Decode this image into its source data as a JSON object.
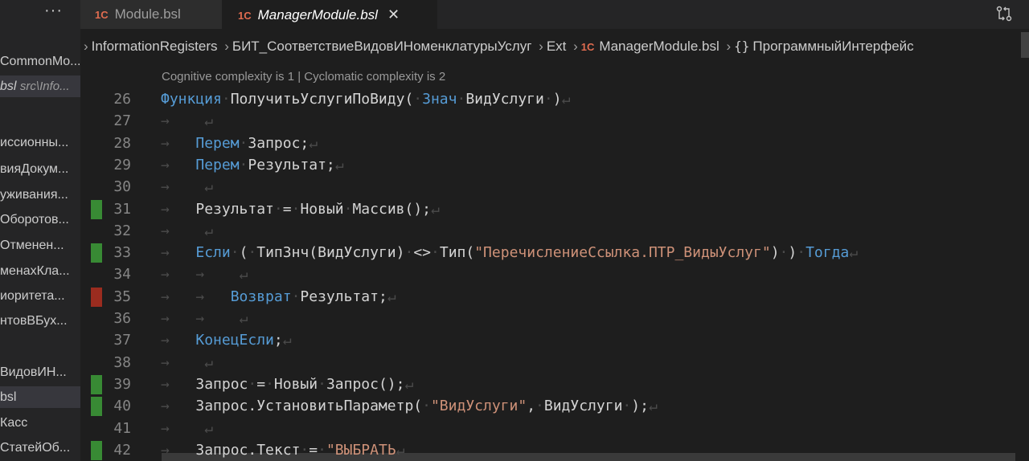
{
  "sidebar": {
    "dots": "···",
    "items": [
      {
        "text": "CommonMo...",
        "sub": "",
        "sel": false
      },
      {
        "text": "bsl",
        "sub": "src\\Info...",
        "sel": true
      },
      {
        "text": "иссионны...",
        "sub": "",
        "sel": false
      },
      {
        "text": "вияДокум...",
        "sub": "",
        "sel": false
      },
      {
        "text": "уживания...",
        "sub": "",
        "sel": false
      },
      {
        "text": "Оборотов...",
        "sub": "",
        "sel": false
      },
      {
        "text": "Отменен...",
        "sub": "",
        "sel": false
      },
      {
        "text": "менахКла...",
        "sub": "",
        "sel": false
      },
      {
        "text": "иоритета...",
        "sub": "",
        "sel": false
      },
      {
        "text": "нтовВБух...",
        "sub": "",
        "sel": false
      },
      {
        "text": "ВидовИН...",
        "sub": "",
        "sel": false
      },
      {
        "text": "bsl",
        "sub": "",
        "sel": true
      },
      {
        "text": "Касс",
        "sub": "",
        "sel": false
      },
      {
        "text": "СтатейОб...",
        "sub": "",
        "sel": false
      }
    ]
  },
  "tabs": [
    {
      "logo": "1C",
      "name": "Module.bsl",
      "active": false
    },
    {
      "logo": "1C",
      "name": "ManagerModule.bsl",
      "active": true,
      "close": "✕"
    }
  ],
  "breadcrumb": {
    "parts": [
      "InformationRegisters",
      "БИТ_СоответствиеВидовИНоменклатурыУслуг",
      "Ext",
      "ManagerModule.bsl",
      "ПрограммныйИнтерфейс"
    ],
    "logo": "1C",
    "braces": "{}"
  },
  "editor": {
    "codelens": "Cognitive complexity is 1 | Cyclomatic complexity is 2",
    "lines": [
      {
        "n": "26",
        "segs": [
          [
            "kw",
            "Функция"
          ],
          [
            "ws",
            "·"
          ],
          [
            "plain",
            "ПолучитьУслугиПоВиду("
          ],
          [
            "ws",
            "·"
          ],
          [
            "kw",
            "Знач"
          ],
          [
            "ws",
            "·"
          ],
          [
            "plain",
            "ВидУслуги"
          ],
          [
            "ws",
            "·"
          ],
          [
            "plain",
            ")"
          ],
          [
            "ws",
            "↵"
          ]
        ],
        "git": ""
      },
      {
        "n": "27",
        "segs": [
          [
            "ws",
            "→    ↵"
          ]
        ],
        "git": ""
      },
      {
        "n": "28",
        "segs": [
          [
            "ws",
            "→   "
          ],
          [
            "kw",
            "Перем"
          ],
          [
            "ws",
            "·"
          ],
          [
            "plain",
            "Запрос;"
          ],
          [
            "ws",
            "↵"
          ]
        ],
        "git": ""
      },
      {
        "n": "29",
        "segs": [
          [
            "ws",
            "→   "
          ],
          [
            "kw",
            "Перем"
          ],
          [
            "ws",
            "·"
          ],
          [
            "plain",
            "Результат;"
          ],
          [
            "ws",
            "↵"
          ]
        ],
        "git": ""
      },
      {
        "n": "30",
        "segs": [
          [
            "ws",
            "→    ↵"
          ]
        ],
        "git": ""
      },
      {
        "n": "31",
        "segs": [
          [
            "ws",
            "→   "
          ],
          [
            "plain",
            "Результат"
          ],
          [
            "ws",
            "·"
          ],
          [
            "plain",
            "="
          ],
          [
            "ws",
            "·"
          ],
          [
            "plain",
            "Новый"
          ],
          [
            "ws",
            "·"
          ],
          [
            "plain",
            "Массив();"
          ],
          [
            "ws",
            "↵"
          ]
        ],
        "git": "added"
      },
      {
        "n": "32",
        "segs": [
          [
            "ws",
            "→    ↵"
          ]
        ],
        "git": ""
      },
      {
        "n": "33",
        "segs": [
          [
            "ws",
            "→   "
          ],
          [
            "kw",
            "Если"
          ],
          [
            "ws",
            "·"
          ],
          [
            "plain",
            "("
          ],
          [
            "ws",
            "·"
          ],
          [
            "plain",
            "ТипЗнч(ВидУслуги)"
          ],
          [
            "ws",
            "·"
          ],
          [
            "plain",
            "<>"
          ],
          [
            "ws",
            "·"
          ],
          [
            "plain",
            "Тип("
          ],
          [
            "str",
            "\"ПеречислениеСсылка.ПТР_ВидыУслуг\""
          ],
          [
            "plain",
            ")"
          ],
          [
            "ws",
            "·"
          ],
          [
            "plain",
            ")"
          ],
          [
            "ws",
            "·"
          ],
          [
            "kw",
            "Тогда"
          ],
          [
            "ws",
            "↵"
          ]
        ],
        "git": "added"
      },
      {
        "n": "34",
        "segs": [
          [
            "ws",
            "→   →    ↵"
          ]
        ],
        "git": ""
      },
      {
        "n": "35",
        "segs": [
          [
            "ws",
            "→   →   "
          ],
          [
            "kw",
            "Возврат"
          ],
          [
            "ws",
            "·"
          ],
          [
            "plain",
            "Результат;"
          ],
          [
            "ws",
            "↵"
          ]
        ],
        "git": "removed"
      },
      {
        "n": "36",
        "segs": [
          [
            "ws",
            "→   →    ↵"
          ]
        ],
        "git": ""
      },
      {
        "n": "37",
        "segs": [
          [
            "ws",
            "→   "
          ],
          [
            "kw",
            "КонецЕсли"
          ],
          [
            "plain",
            ";"
          ],
          [
            "ws",
            "↵"
          ]
        ],
        "git": ""
      },
      {
        "n": "38",
        "segs": [
          [
            "ws",
            "→    ↵"
          ]
        ],
        "git": ""
      },
      {
        "n": "39",
        "segs": [
          [
            "ws",
            "→   "
          ],
          [
            "plain",
            "Запрос"
          ],
          [
            "ws",
            "·"
          ],
          [
            "plain",
            "="
          ],
          [
            "ws",
            "·"
          ],
          [
            "plain",
            "Новый"
          ],
          [
            "ws",
            "·"
          ],
          [
            "plain",
            "Запрос();"
          ],
          [
            "ws",
            "↵"
          ]
        ],
        "git": "added"
      },
      {
        "n": "40",
        "segs": [
          [
            "ws",
            "→   "
          ],
          [
            "plain",
            "Запрос.УстановитьПараметр("
          ],
          [
            "ws",
            "·"
          ],
          [
            "str",
            "\"ВидУслуги\""
          ],
          [
            "plain",
            ","
          ],
          [
            "ws",
            "·"
          ],
          [
            "plain",
            "ВидУслуги"
          ],
          [
            "ws",
            "·"
          ],
          [
            "plain",
            ");"
          ],
          [
            "ws",
            "↵"
          ]
        ],
        "git": "added"
      },
      {
        "n": "41",
        "segs": [
          [
            "ws",
            "→    ↵"
          ]
        ],
        "git": ""
      },
      {
        "n": "42",
        "segs": [
          [
            "ws",
            "→   "
          ],
          [
            "plain",
            "Запрос.Текст"
          ],
          [
            "ws",
            "·"
          ],
          [
            "plain",
            "="
          ],
          [
            "ws",
            "·"
          ],
          [
            "str",
            "\"ВЫБРАТЬ"
          ],
          [
            "ws",
            "↵"
          ]
        ],
        "git": "added"
      }
    ]
  },
  "colors": {
    "added": "#388a34",
    "removed": "#9b2c1f",
    "keyword": "#569cd6",
    "string": "#ce9178"
  }
}
